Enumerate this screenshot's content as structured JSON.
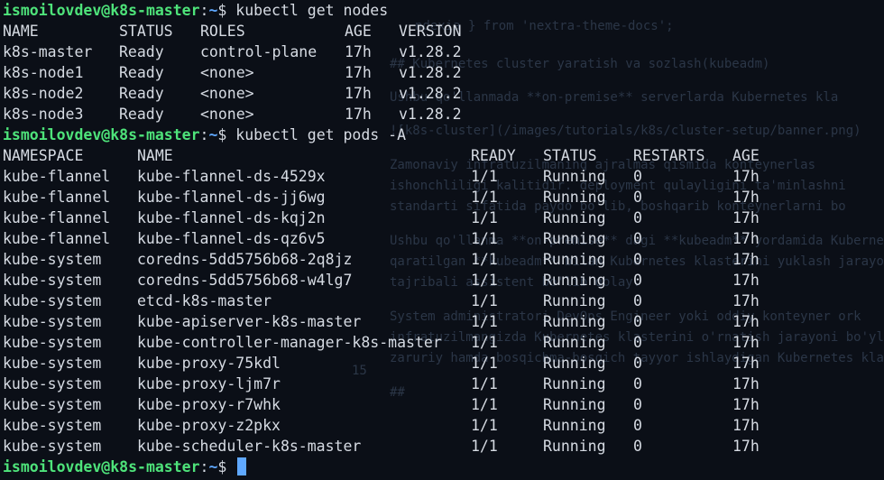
{
  "prompt": {
    "user_host": "ismoilovdev@k8s-master",
    "sep": ":",
    "path": "~",
    "symbol": "$"
  },
  "commands": {
    "get_nodes": "kubectl get nodes",
    "get_pods": "kubectl get pods -A"
  },
  "nodes_table": {
    "headers": [
      "NAME",
      "STATUS",
      "ROLES",
      "AGE",
      "VERSION"
    ],
    "rows": [
      [
        "k8s-master",
        "Ready",
        "control-plane",
        "17h",
        "v1.28.2"
      ],
      [
        "k8s-node1",
        "Ready",
        "<none>",
        "17h",
        "v1.28.2"
      ],
      [
        "k8s-node2",
        "Ready",
        "<none>",
        "17h",
        "v1.28.2"
      ],
      [
        "k8s-node3",
        "Ready",
        "<none>",
        "17h",
        "v1.28.2"
      ]
    ]
  },
  "pods_table": {
    "headers": [
      "NAMESPACE",
      "NAME",
      "READY",
      "STATUS",
      "RESTARTS",
      "AGE"
    ],
    "rows": [
      [
        "kube-flannel",
        "kube-flannel-ds-4529x",
        "1/1",
        "Running",
        "0",
        "17h"
      ],
      [
        "kube-flannel",
        "kube-flannel-ds-jj6wg",
        "1/1",
        "Running",
        "0",
        "17h"
      ],
      [
        "kube-flannel",
        "kube-flannel-ds-kqj2n",
        "1/1",
        "Running",
        "0",
        "17h"
      ],
      [
        "kube-flannel",
        "kube-flannel-ds-qz6v5",
        "1/1",
        "Running",
        "0",
        "17h"
      ],
      [
        "kube-system",
        "coredns-5dd5756b68-2q8jz",
        "1/1",
        "Running",
        "0",
        "17h"
      ],
      [
        "kube-system",
        "coredns-5dd5756b68-w4lg7",
        "1/1",
        "Running",
        "0",
        "17h"
      ],
      [
        "kube-system",
        "etcd-k8s-master",
        "1/1",
        "Running",
        "0",
        "17h"
      ],
      [
        "kube-system",
        "kube-apiserver-k8s-master",
        "1/1",
        "Running",
        "0",
        "17h"
      ],
      [
        "kube-system",
        "kube-controller-manager-k8s-master",
        "1/1",
        "Running",
        "0",
        "17h"
      ],
      [
        "kube-system",
        "kube-proxy-75kdl",
        "1/1",
        "Running",
        "0",
        "17h"
      ],
      [
        "kube-system",
        "kube-proxy-ljm7r",
        "1/1",
        "Running",
        "0",
        "17h"
      ],
      [
        "kube-system",
        "kube-proxy-r7whk",
        "1/1",
        "Running",
        "0",
        "17h"
      ],
      [
        "kube-system",
        "kube-proxy-z2pkx",
        "1/1",
        "Running",
        "0",
        "17h"
      ],
      [
        "kube-system",
        "kube-scheduler-k8s-master",
        "1/1",
        "Running",
        "0",
        "17h"
      ]
    ]
  },
  "colors": {
    "background": "#0b0f17",
    "prompt_user": "#4ee37a",
    "prompt_path": "#5fa8ff",
    "text": "#d6dbe3",
    "cursor": "#5fa8ff"
  }
}
